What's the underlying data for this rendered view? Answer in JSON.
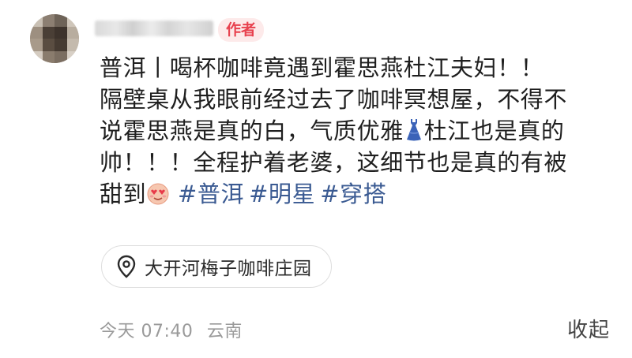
{
  "post": {
    "author_badge": "作者",
    "lines": [
      "普洱丨喝杯咖啡竟遇到霍思燕杜江夫妇！！",
      "隔壁桌从我眼前经过去了咖啡冥想屋，不得不",
      "说霍思燕是真的白，气质优雅",
      "杜江也是真的",
      "帅！！！全程护着老婆，这细节也是真的有被",
      "甜到"
    ],
    "tags": [
      "#普洱",
      "#明星",
      "#穿搭"
    ],
    "emoji_dress": "dress-icon",
    "emoji_face": "heart-eyes-face-icon"
  },
  "location": {
    "icon": "location-pin-icon",
    "name": "大开河梅子咖啡庄园"
  },
  "meta": {
    "time": "今天 07:40",
    "region": "云南"
  },
  "actions": {
    "collapse_label": "收起"
  },
  "colors": {
    "author_badge_text": "#e8424f",
    "author_badge_bg": "#fdeaea",
    "tag": "#3a5a92",
    "meta_text": "#9a9a9a"
  }
}
